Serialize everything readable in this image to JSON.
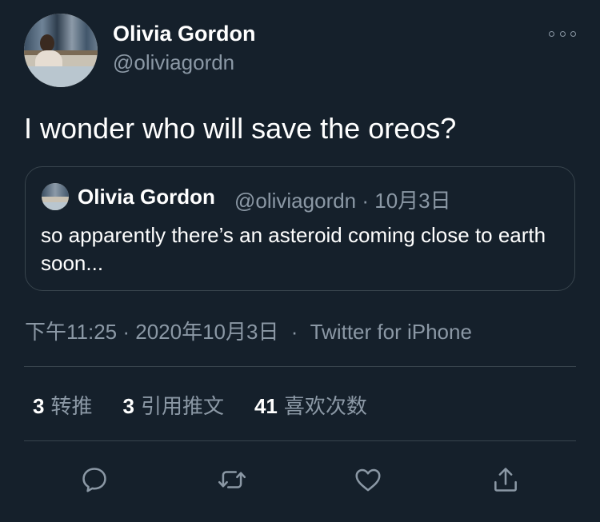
{
  "tweet": {
    "author": {
      "name": "Olivia Gordon",
      "handle": "@oliviagordn"
    },
    "text": "I wonder who will save the oreos?",
    "quoted": {
      "name": "Olivia Gordon",
      "meta": "@oliviagordn · 10月3日",
      "text": "so apparently there’s an asteroid coming close to earth soon..."
    },
    "time": "下午11:25 · 2020年10月3日",
    "separator": "·",
    "source": "Twitter for iPhone",
    "stats": [
      {
        "count": "3",
        "label": "转推"
      },
      {
        "count": "3",
        "label": "引用推文"
      },
      {
        "count": "41",
        "label": "喜欢次数"
      }
    ]
  },
  "icons": {
    "more": "more-horizontal-icon",
    "reply": "reply-icon",
    "retweet": "retweet-icon",
    "like": "heart-icon",
    "share": "share-icon"
  },
  "colors": {
    "background": "#15202b",
    "text": "#ffffff",
    "muted": "#8b98a5",
    "border": "#38444d"
  }
}
